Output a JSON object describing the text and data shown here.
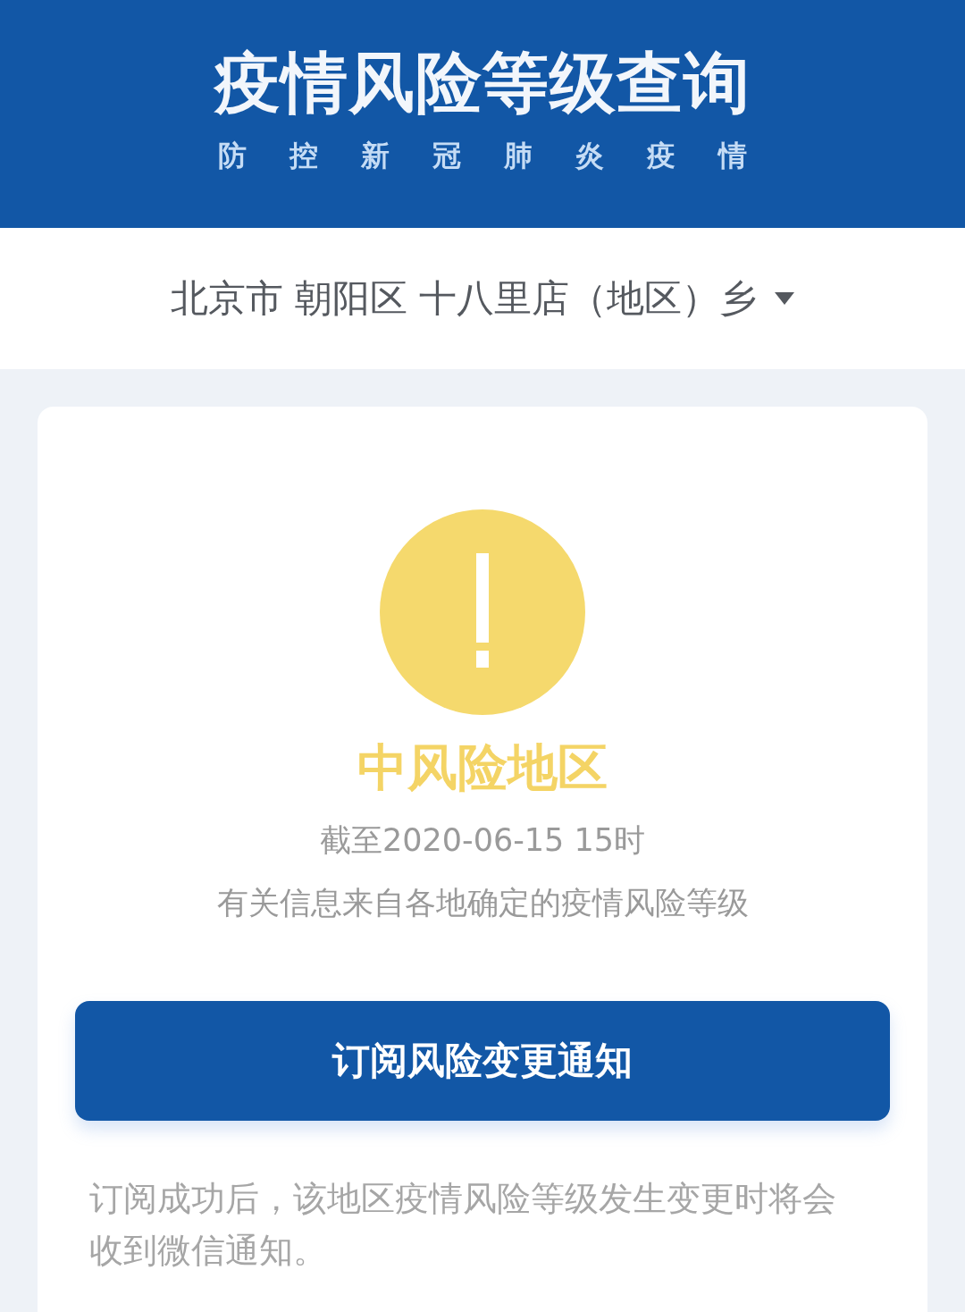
{
  "header": {
    "title": "疫情风险等级查询",
    "subtitle": "防控新冠肺炎疫情"
  },
  "location": {
    "value": "北京市 朝阳区 十八里店（地区）乡"
  },
  "risk": {
    "kind": "medium",
    "label": "中风险地区",
    "updated": "截至2020-06-15 15时",
    "source_note": "有关信息来自各地确定的疫情风险等级"
  },
  "subscribe_button": {
    "label": "订阅风险变更通知"
  },
  "subscribe_note": "订阅成功后，该地区疫情风险等级发生变更时将会收到微信通知。"
}
